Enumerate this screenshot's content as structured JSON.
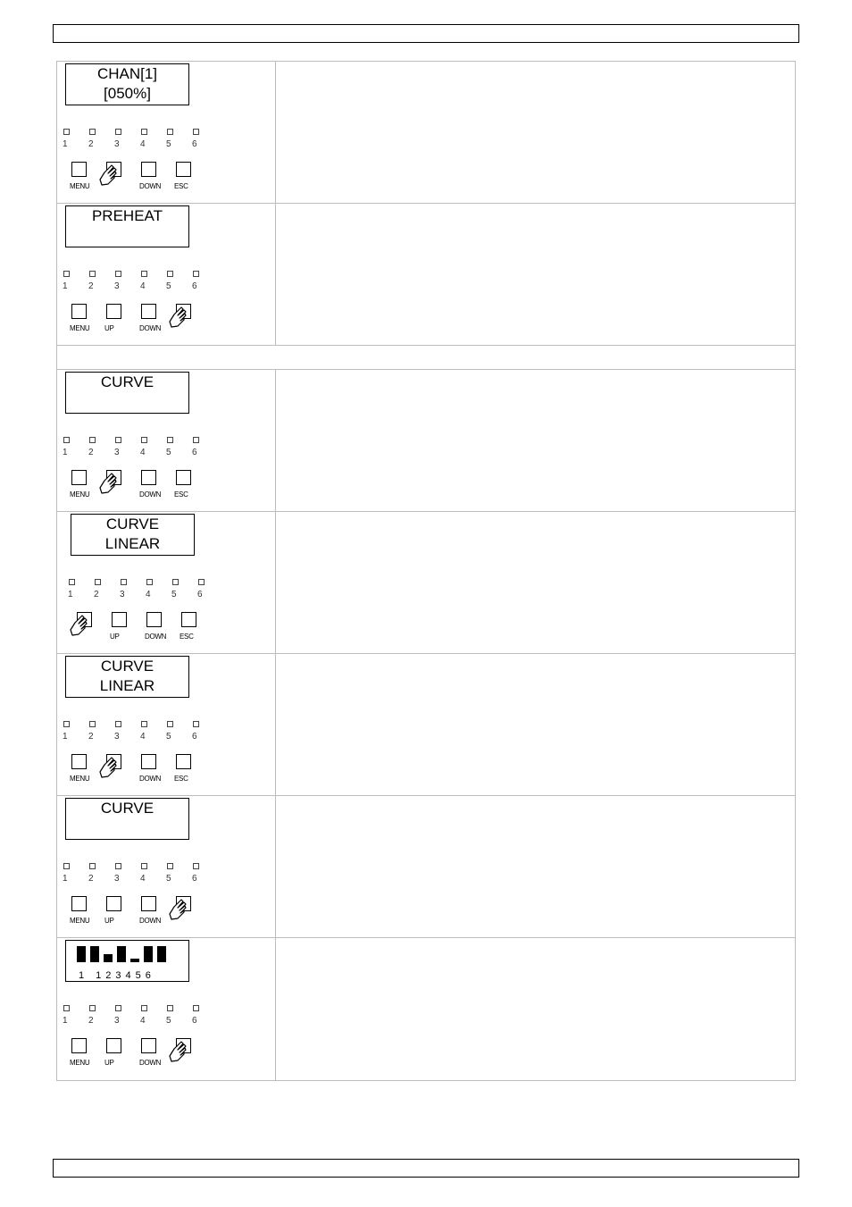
{
  "rows": [
    {
      "type": "step",
      "lcd": [
        "CHAN[1]",
        "[050%]"
      ],
      "leds": [
        "1",
        "2",
        "3",
        "4",
        "5",
        "6"
      ],
      "buttons": [
        "MENU",
        "",
        "DOWN",
        "ESC"
      ],
      "pressed": 1
    },
    {
      "type": "step",
      "lcd": [
        "PREHEAT",
        ""
      ],
      "leds": [
        "1",
        "2",
        "3",
        "4",
        "5",
        "6"
      ],
      "buttons": [
        "MENU",
        "UP",
        "DOWN",
        ""
      ],
      "pressed": 3
    },
    {
      "type": "spacer"
    },
    {
      "type": "step",
      "lcd": [
        "CURVE",
        ""
      ],
      "leds": [
        "1",
        "2",
        "3",
        "4",
        "5",
        "6"
      ],
      "buttons": [
        "MENU",
        "",
        "DOWN",
        "ESC"
      ],
      "pressed": 1
    },
    {
      "type": "step",
      "lcd": [
        "CURVE",
        "LINEAR"
      ],
      "leds": [
        "1",
        "2",
        "3",
        "4",
        "5",
        "6"
      ],
      "buttons": [
        "",
        "UP",
        "DOWN",
        "ESC"
      ],
      "pressed": 0
    },
    {
      "type": "step",
      "lcd": [
        "CURVE",
        "LINEAR"
      ],
      "leds": [
        "1",
        "2",
        "3",
        "4",
        "5",
        "6"
      ],
      "buttons": [
        "MENU",
        "",
        "DOWN",
        "ESC"
      ],
      "pressed": 1
    },
    {
      "type": "step",
      "lcd": [
        "CURVE",
        ""
      ],
      "leds": [
        "1",
        "2",
        "3",
        "4",
        "5",
        "6"
      ],
      "buttons": [
        "MENU",
        "UP",
        "DOWN",
        ""
      ],
      "pressed": 3
    },
    {
      "type": "bars",
      "bar_labels": "1 123456",
      "bar_levels": [
        1,
        1,
        0.5,
        1,
        0.2,
        1,
        1
      ],
      "leds": [
        "1",
        "2",
        "3",
        "4",
        "5",
        "6"
      ],
      "buttons": [
        "MENU",
        "UP",
        "DOWN",
        ""
      ],
      "pressed": 3
    }
  ]
}
